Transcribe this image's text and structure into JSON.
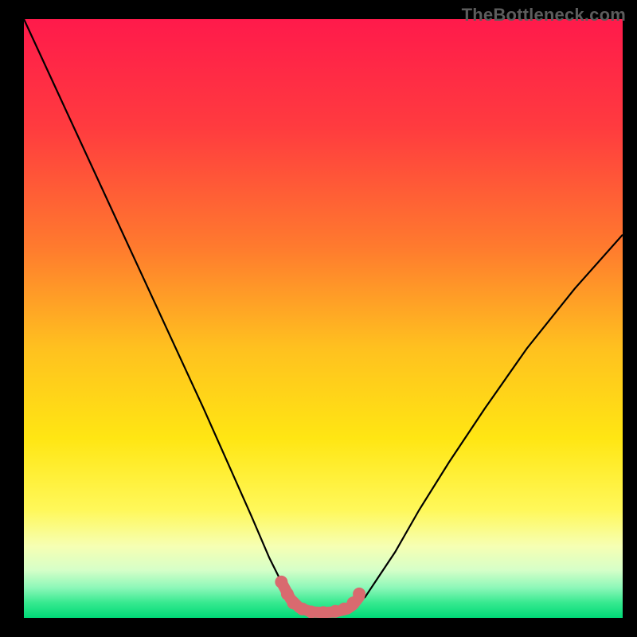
{
  "watermark": "TheBottleneck.com",
  "chart_data": {
    "type": "line",
    "title": "",
    "xlabel": "",
    "ylabel": "",
    "xlim": [
      0,
      100
    ],
    "ylim": [
      0,
      100
    ],
    "gradient_stops": [
      {
        "offset": 0.0,
        "color": "#ff1a4b"
      },
      {
        "offset": 0.18,
        "color": "#ff3b3f"
      },
      {
        "offset": 0.38,
        "color": "#ff7a2e"
      },
      {
        "offset": 0.55,
        "color": "#ffc11f"
      },
      {
        "offset": 0.7,
        "color": "#ffe613"
      },
      {
        "offset": 0.82,
        "color": "#fff85a"
      },
      {
        "offset": 0.88,
        "color": "#f6ffb3"
      },
      {
        "offset": 0.92,
        "color": "#d6ffc8"
      },
      {
        "offset": 0.95,
        "color": "#8bf7b8"
      },
      {
        "offset": 0.975,
        "color": "#36e98f"
      },
      {
        "offset": 1.0,
        "color": "#00d977"
      }
    ],
    "series": [
      {
        "name": "left-curve",
        "x": [
          0,
          6,
          12,
          18,
          24,
          30,
          34,
          38,
          41,
          43,
          44.5,
          46
        ],
        "y": [
          100,
          87,
          74,
          61,
          48,
          35,
          26,
          17,
          10,
          6,
          3.2,
          1.7
        ]
      },
      {
        "name": "right-curve",
        "x": [
          55,
          57,
          59,
          62,
          66,
          71,
          77,
          84,
          92,
          100
        ],
        "y": [
          1.8,
          3.5,
          6.5,
          11,
          18,
          26,
          35,
          45,
          55,
          64
        ]
      },
      {
        "name": "valley-highlight",
        "x": [
          43,
          44.5,
          46,
          48,
          50,
          52,
          54,
          55,
          56
        ],
        "y": [
          6.0,
          3.2,
          1.7,
          1.0,
          0.9,
          1.0,
          1.5,
          2.2,
          3.5
        ]
      }
    ],
    "markers": [
      {
        "x": 43.0,
        "y": 6.0
      },
      {
        "x": 44.0,
        "y": 4.0
      },
      {
        "x": 45.0,
        "y": 2.5
      },
      {
        "x": 46.5,
        "y": 1.5
      },
      {
        "x": 48.0,
        "y": 1.0
      },
      {
        "x": 50.0,
        "y": 0.9
      },
      {
        "x": 52.0,
        "y": 1.1
      },
      {
        "x": 53.5,
        "y": 1.5
      },
      {
        "x": 55.0,
        "y": 2.5
      },
      {
        "x": 56.0,
        "y": 4.0
      }
    ],
    "highlight_color": "#d96a6f",
    "curve_color": "#000000"
  }
}
